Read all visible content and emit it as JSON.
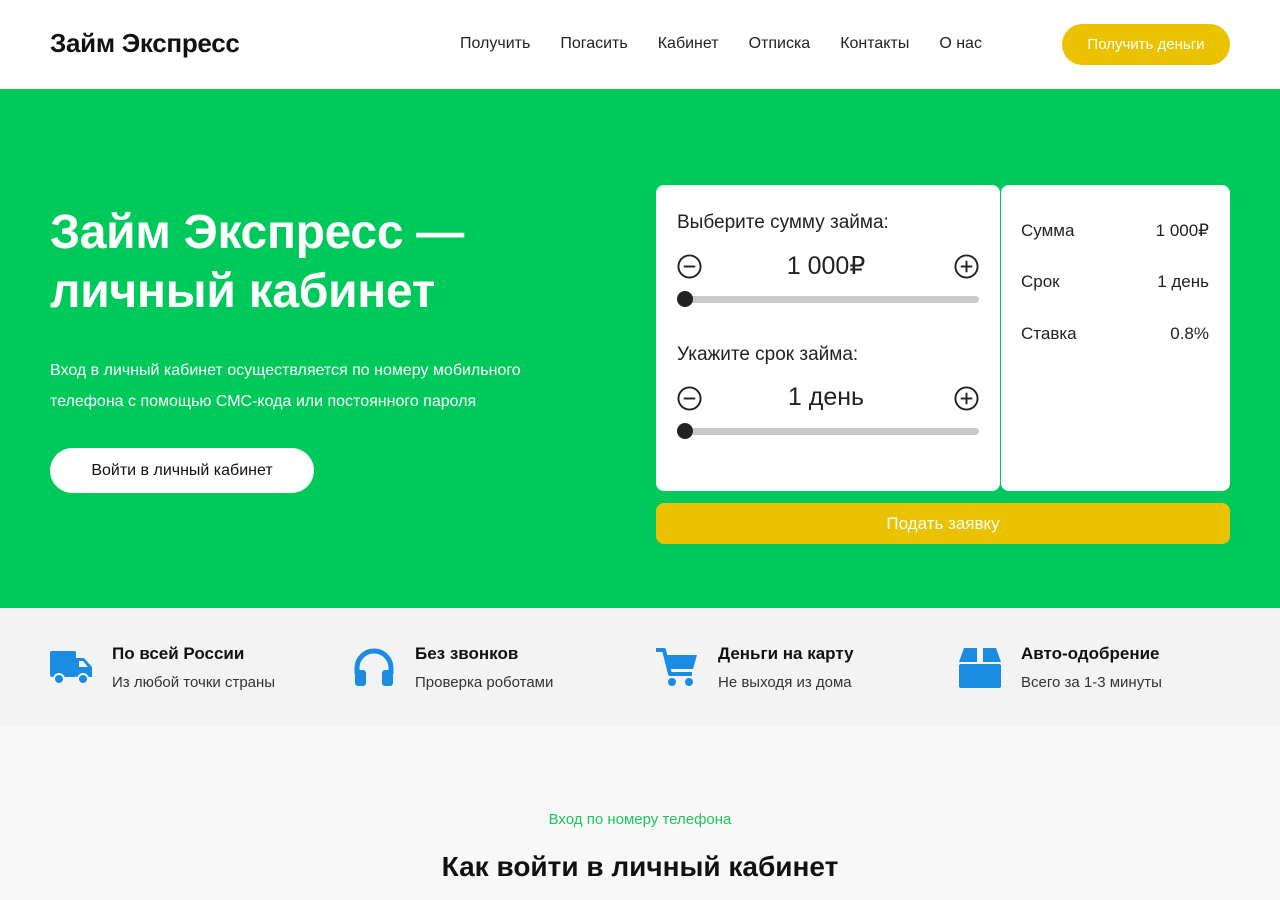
{
  "header": {
    "logo": "Займ Экспресс",
    "nav": [
      "Получить",
      "Погасить",
      "Кабинет",
      "Отписка",
      "Контакты",
      "О нас"
    ],
    "cta": "Получить деньги"
  },
  "hero": {
    "title_line1": "Займ Экспресс —",
    "title_line2": "личный кабинет",
    "desc_line1": "Вход в личный кабинет осуществляется по номеру мобильного",
    "desc_line2": "телефона с помощью СМС-кода или постоянного пароля",
    "login_button": "Войти в личный кабинет"
  },
  "calculator": {
    "amount_label": "Выберите сумму займа:",
    "amount_value": "1 000₽",
    "amount_slider_fraction": 0,
    "term_label": "Укажите срок займа:",
    "term_value": "1 день",
    "term_slider_fraction": 0,
    "apply_button": "Подать заявку"
  },
  "summary": {
    "rows": [
      {
        "label": "Сумма",
        "value": "1 000₽"
      },
      {
        "label": "Срок",
        "value": "1 день"
      },
      {
        "label": "Ставка",
        "value": "0.8%"
      }
    ]
  },
  "features": [
    {
      "icon": "truck-icon",
      "title": "По всей России",
      "subtitle": "Из любой точки страны"
    },
    {
      "icon": "headphones-icon",
      "title": "Без звонков",
      "subtitle": "Проверка роботами"
    },
    {
      "icon": "cart-icon",
      "title": "Деньги на карту",
      "subtitle": "Не выходя из дома"
    },
    {
      "icon": "box-icon",
      "title": "Авто-одобрение",
      "subtitle": "Всего за 1-3 минуты"
    }
  ],
  "section": {
    "eyebrow": "Вход по номеру телефона",
    "title": "Как войти в личный кабинет"
  },
  "colors": {
    "brand_green": "#00c95b",
    "accent_yellow": "#eac200",
    "icon_blue": "#1a8de3"
  }
}
